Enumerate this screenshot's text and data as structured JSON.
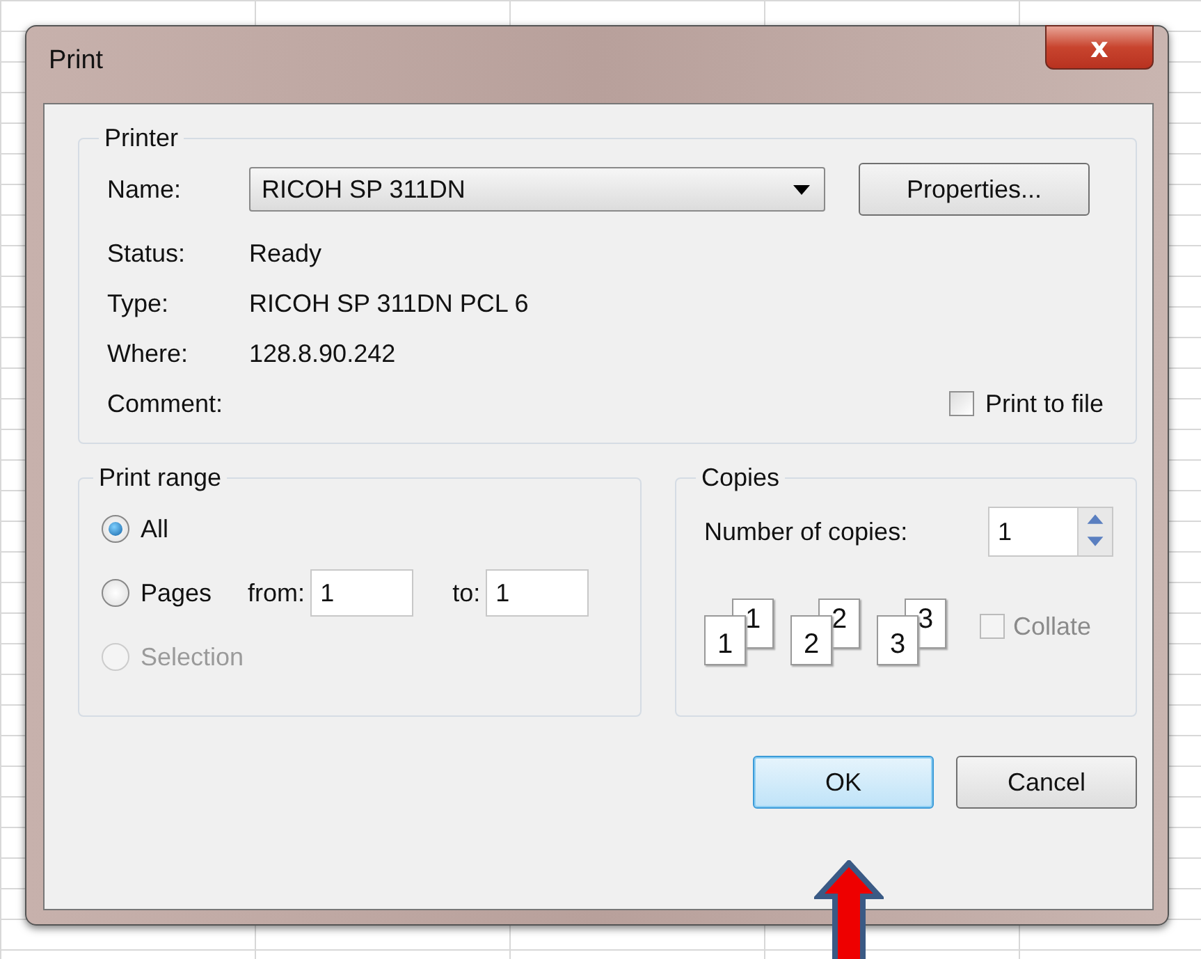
{
  "window": {
    "title": "Print",
    "close_icon": "x"
  },
  "printer": {
    "title": "Printer",
    "name_label": "Name:",
    "name_value": "RICOH SP 311DN",
    "properties_button": "Properties...",
    "info": [
      {
        "label": "Status:",
        "value": "Ready"
      },
      {
        "label": "Type:",
        "value": "RICOH SP 311DN PCL 6"
      },
      {
        "label": "Where:",
        "value": "128.8.90.242"
      },
      {
        "label": "Comment:"
      }
    ],
    "print_to_file": {
      "label": "Print to file",
      "checked": false
    }
  },
  "print_range": {
    "title": "Print range",
    "options": [
      {
        "label": "All",
        "selected": true,
        "disabled": false
      },
      {
        "label": "Pages",
        "selected": false,
        "disabled": false
      },
      {
        "label": "Selection",
        "selected": false,
        "disabled": true
      }
    ],
    "from": {
      "label": "from:",
      "value": "1"
    },
    "to": {
      "label": "to:",
      "value": "1"
    }
  },
  "copies": {
    "title": "Copies",
    "label": "Number of copies:",
    "value": "1",
    "sets": [
      {
        "back": "1",
        "front": "1"
      },
      {
        "back": "2",
        "front": "2"
      },
      {
        "back": "3",
        "front": "3"
      }
    ],
    "collate": {
      "label": "Collate",
      "checked": false,
      "disabled": true
    }
  },
  "buttons": [
    {
      "label": "OK",
      "default": true
    },
    {
      "label": "Cancel",
      "default": false
    }
  ]
}
